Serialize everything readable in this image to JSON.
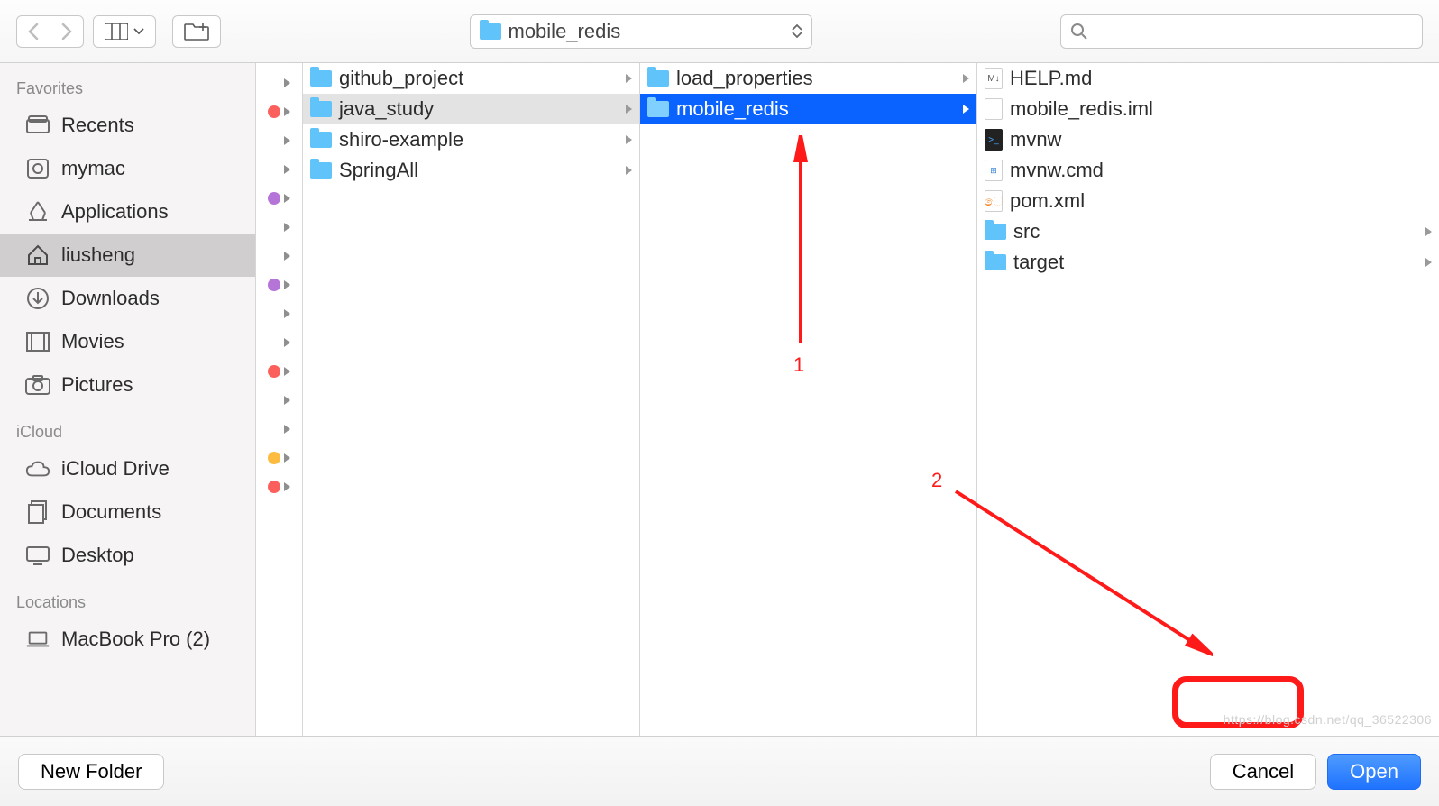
{
  "toolbar": {
    "current_folder": "mobile_redis",
    "search_placeholder": ""
  },
  "sidebar": {
    "sections": [
      {
        "header": "Favorites",
        "items": [
          {
            "icon": "recents",
            "label": "Recents"
          },
          {
            "icon": "disk",
            "label": "mymac"
          },
          {
            "icon": "apps",
            "label": "Applications"
          },
          {
            "icon": "home",
            "label": "liusheng",
            "selected": true
          },
          {
            "icon": "download",
            "label": "Downloads"
          },
          {
            "icon": "movies",
            "label": "Movies"
          },
          {
            "icon": "pictures",
            "label": "Pictures"
          }
        ]
      },
      {
        "header": "iCloud",
        "items": [
          {
            "icon": "cloud",
            "label": "iCloud Drive"
          },
          {
            "icon": "docs",
            "label": "Documents"
          },
          {
            "icon": "desktop",
            "label": "Desktop"
          }
        ]
      },
      {
        "header": "Locations",
        "items": [
          {
            "icon": "laptop",
            "label": "MacBook Pro (2)"
          }
        ]
      }
    ]
  },
  "tag_rows": [
    {
      "dot": null
    },
    {
      "dot": "red"
    },
    {
      "dot": null
    },
    {
      "dot": null
    },
    {
      "dot": "purple"
    },
    {
      "dot": null
    },
    {
      "dot": null
    },
    {
      "dot": "purple"
    },
    {
      "dot": null
    },
    {
      "dot": null
    },
    {
      "dot": "red"
    },
    {
      "dot": null
    },
    {
      "dot": null
    },
    {
      "dot": "orange"
    },
    {
      "dot": "red"
    }
  ],
  "col1": [
    {
      "name": "github_project",
      "chev": true
    },
    {
      "name": "java_study",
      "chev": true,
      "sel": "gray"
    },
    {
      "name": "shiro-example",
      "chev": true
    },
    {
      "name": "SpringAll",
      "chev": true
    }
  ],
  "col2": [
    {
      "name": "load_properties",
      "chev": true
    },
    {
      "name": "mobile_redis",
      "chev": true,
      "sel": "blue"
    }
  ],
  "col3": [
    {
      "name": "HELP.md",
      "type": "md"
    },
    {
      "name": "mobile_redis.iml",
      "type": "file"
    },
    {
      "name": "mvnw",
      "type": "term"
    },
    {
      "name": "mvnw.cmd",
      "type": "win"
    },
    {
      "name": "pom.xml",
      "type": "xml"
    },
    {
      "name": "src",
      "type": "folder",
      "chev": true
    },
    {
      "name": "target",
      "type": "folder",
      "chev": true
    }
  ],
  "footer": {
    "new_folder": "New Folder",
    "cancel": "Cancel",
    "open": "Open"
  },
  "annotations": {
    "label1": "1",
    "label2": "2"
  },
  "watermark": "https://blog.csdn.net/qq_36522306"
}
